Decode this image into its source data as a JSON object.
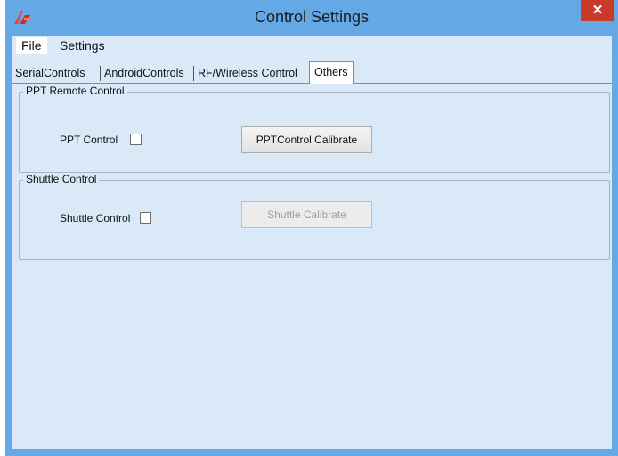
{
  "window": {
    "title": "Control Settings",
    "close_glyph": "✕",
    "app_icon": "app-logo-icon"
  },
  "menu": {
    "items": [
      {
        "label": "File",
        "active": true
      },
      {
        "label": "Settings",
        "active": false
      }
    ]
  },
  "tabs": [
    {
      "label": "SerialControls",
      "selected": false
    },
    {
      "label": "AndroidControls",
      "selected": false
    },
    {
      "label": "RF/Wireless Control",
      "selected": false
    },
    {
      "label": "Others",
      "selected": true
    }
  ],
  "ppt_group": {
    "title": "PPT Remote Control",
    "checkbox_label": "PPT  Control",
    "checked": false,
    "button_label": "PPTControl Calibrate",
    "button_enabled": true
  },
  "shuttle_group": {
    "title": "Shuttle Control",
    "checkbox_label": "Shuttle Control",
    "checked": false,
    "button_label": "Shuttle Calibrate",
    "button_enabled": false
  },
  "colors": {
    "frame": "#64a8e6",
    "client": "#d9e9f7",
    "close_button": "#c83a2a"
  }
}
